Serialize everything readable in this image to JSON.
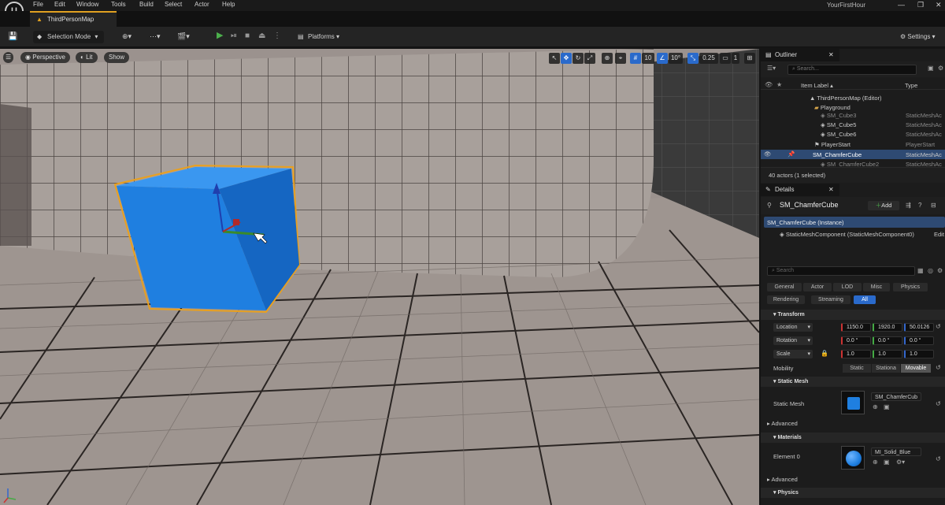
{
  "menu": [
    "File",
    "Edit",
    "Window",
    "Tools",
    "Build",
    "Select",
    "Actor",
    "Help"
  ],
  "project_name": "YourFirstHour",
  "window_controls": [
    "—",
    "❐",
    "✕"
  ],
  "tab": {
    "title": "ThirdPersonMap"
  },
  "toolbar": {
    "selection_mode": "Selection Mode",
    "platforms": "Platforms",
    "settings": "Settings"
  },
  "viewport": {
    "perspective": "Perspective",
    "lit": "Lit",
    "show": "Show",
    "grid_snap": "10",
    "rotation_snap": "10°",
    "scale_snap": "0.25",
    "camera_speed": "1"
  },
  "outliner": {
    "title": "Outliner",
    "search_placeholder": "Search...",
    "col_label": "Item Label ▴",
    "col_type": "Type",
    "items": [
      {
        "label": "ThirdPersonMap (Editor)",
        "type": ""
      },
      {
        "label": "Playground",
        "type": ""
      },
      {
        "label": "SM_Cube3",
        "type": "StaticMeshAc"
      },
      {
        "label": "SM_Cube5",
        "type": "StaticMeshAc"
      },
      {
        "label": "SM_Cube6",
        "type": "StaticMeshAc"
      },
      {
        "label": "PlayerStart",
        "type": "PlayerStart"
      },
      {
        "label": "SM_ChamferCube",
        "type": "StaticMeshAc"
      },
      {
        "label": "SM_ChamferCube2",
        "type": "StaticMeshAc"
      }
    ],
    "status": "40 actors (1 selected)"
  },
  "details": {
    "title": "Details",
    "actor_name": "SM_ChamferCube",
    "add_label": "Add",
    "instance": "SM_ChamferCube (Instance)",
    "component": "StaticMeshComponent (StaticMeshComponent0)",
    "component_edit": "Edit",
    "search_placeholder": "Search",
    "categories_row1": [
      "General",
      "Actor",
      "LOD",
      "Misc",
      "Physics"
    ],
    "categories_row2": [
      "Rendering",
      "Streaming",
      "All"
    ],
    "transform": {
      "header": "Transform",
      "location_label": "Location",
      "location": [
        "1150.0",
        "1920.0",
        "50.0126"
      ],
      "rotation_label": "Rotation",
      "rotation": [
        "0.0 °",
        "0.0 °",
        "0.0 °"
      ],
      "scale_label": "Scale",
      "scale": [
        "1.0",
        "1.0",
        "1.0"
      ],
      "mobility_label": "Mobility",
      "mobility_options": [
        "Static",
        "Stationa",
        "Movable"
      ]
    },
    "static_mesh": {
      "header": "Static Mesh",
      "label": "Static Mesh",
      "value": "SM_ChamferCub",
      "advanced": "Advanced"
    },
    "materials": {
      "header": "Materials",
      "label": "Element 0",
      "value": "MI_Solid_Blue",
      "advanced": "Advanced"
    },
    "physics": {
      "header": "Physics"
    }
  },
  "colors": {
    "accent": "#2a6acb",
    "cube": "#1f7fe0",
    "selection_outline": "#e8a020",
    "play_green": "#4cb04c"
  }
}
